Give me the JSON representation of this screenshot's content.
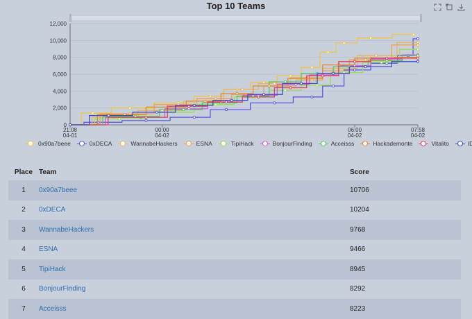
{
  "chart_data": {
    "type": "line",
    "title": "Top 10 Teams",
    "x_ticks": [
      {
        "time": "21:08",
        "date": "04-01"
      },
      {
        "time": "00:00",
        "date": "04-02"
      },
      {
        "time": "06:00",
        "date": "04-02"
      },
      {
        "time": "07:58",
        "date": "04-02"
      }
    ],
    "x_range": [
      "04-01 21:08",
      "04-02 07:58"
    ],
    "ylim": [
      0,
      12000
    ],
    "y_ticks": [
      "0",
      "2,000",
      "4,000",
      "6,000",
      "8,000",
      "10,000",
      "12,000"
    ],
    "legend_position": "bottom",
    "series": [
      {
        "name": "0x90a7beee",
        "color": "#f2c349",
        "points": [
          [
            "21:08",
            0
          ],
          [
            "21:50",
            1400
          ],
          [
            "23:00",
            2000
          ],
          [
            "00:30",
            2600
          ],
          [
            "01:30",
            3400
          ],
          [
            "02:20",
            4200
          ],
          [
            "03:10",
            5000
          ],
          [
            "04:00",
            5800
          ],
          [
            "04:40",
            6800
          ],
          [
            "05:10",
            8600
          ],
          [
            "05:40",
            9700
          ],
          [
            "06:30",
            10300
          ],
          [
            "07:50",
            10706
          ]
        ]
      },
      {
        "name": "0xDECA",
        "color": "#5a55e6",
        "points": [
          [
            "21:08",
            0
          ],
          [
            "22:00",
            300
          ],
          [
            "23:30",
            500
          ],
          [
            "01:00",
            900
          ],
          [
            "02:00",
            1800
          ],
          [
            "03:30",
            2600
          ],
          [
            "04:40",
            3300
          ],
          [
            "05:20",
            4600
          ],
          [
            "06:00",
            6500
          ],
          [
            "07:00",
            7300
          ],
          [
            "07:40",
            8200
          ],
          [
            "07:58",
            10204
          ]
        ]
      },
      {
        "name": "WannabeHackers",
        "color": "#e8b55a",
        "points": [
          [
            "21:08",
            0
          ],
          [
            "22:30",
            900
          ],
          [
            "00:00",
            1700
          ],
          [
            "01:20",
            2800
          ],
          [
            "02:30",
            4200
          ],
          [
            "03:30",
            4900
          ],
          [
            "04:30",
            5600
          ],
          [
            "05:30",
            6700
          ],
          [
            "06:40",
            8200
          ],
          [
            "07:58",
            9768
          ]
        ]
      },
      {
        "name": "ESNA",
        "color": "#f0a050",
        "points": [
          [
            "21:08",
            0
          ],
          [
            "23:00",
            1300
          ],
          [
            "00:30",
            2400
          ],
          [
            "01:40",
            3100
          ],
          [
            "02:40",
            3600
          ],
          [
            "03:40",
            4600
          ],
          [
            "04:40",
            5300
          ],
          [
            "05:20",
            6400
          ],
          [
            "06:20",
            7700
          ],
          [
            "07:58",
            9466
          ]
        ]
      },
      {
        "name": "TipiHack",
        "color": "#9bdc55",
        "points": [
          [
            "21:08",
            0
          ],
          [
            "22:40",
            700
          ],
          [
            "00:20",
            1500
          ],
          [
            "01:40",
            2400
          ],
          [
            "02:50",
            3300
          ],
          [
            "03:50",
            4100
          ],
          [
            "04:50",
            4700
          ],
          [
            "05:40",
            6200
          ],
          [
            "06:50",
            7400
          ],
          [
            "07:58",
            8945
          ]
        ]
      },
      {
        "name": "BonjourFinding",
        "color": "#d159d8",
        "points": [
          [
            "21:08",
            0
          ],
          [
            "23:20",
            900
          ],
          [
            "00:50",
            1900
          ],
          [
            "02:00",
            2700
          ],
          [
            "03:00",
            3500
          ],
          [
            "04:10",
            4800
          ],
          [
            "05:00",
            5900
          ],
          [
            "06:00",
            7000
          ],
          [
            "07:00",
            7800
          ],
          [
            "07:58",
            8292
          ]
        ]
      },
      {
        "name": "Acceisss",
        "color": "#57c26a",
        "points": [
          [
            "21:08",
            0
          ],
          [
            "23:10",
            1000
          ],
          [
            "00:40",
            1800
          ],
          [
            "01:50",
            2600
          ],
          [
            "02:50",
            3400
          ],
          [
            "03:50",
            5100
          ],
          [
            "04:50",
            6100
          ],
          [
            "05:50",
            6900
          ],
          [
            "07:00",
            7600
          ],
          [
            "07:58",
            8223
          ]
        ]
      },
      {
        "name": "Hackademonte",
        "color": "#e08833",
        "points": [
          [
            "21:08",
            0
          ],
          [
            "22:50",
            1200
          ],
          [
            "00:10",
            2100
          ],
          [
            "01:20",
            2800
          ],
          [
            "02:20",
            3700
          ],
          [
            "03:20",
            4600
          ],
          [
            "04:30",
            5500
          ],
          [
            "05:30",
            7100
          ],
          [
            "06:30",
            7900
          ],
          [
            "07:58",
            8000
          ]
        ]
      },
      {
        "name": "Vitalito",
        "color": "#e0405a",
        "points": [
          [
            "21:08",
            0
          ],
          [
            "23:30",
            900
          ],
          [
            "00:50",
            2200
          ],
          [
            "02:00",
            2700
          ],
          [
            "03:00",
            3300
          ],
          [
            "04:00",
            4400
          ],
          [
            "05:00",
            5800
          ],
          [
            "06:00",
            7500
          ],
          [
            "07:00",
            7900
          ],
          [
            "07:58",
            7900
          ]
        ]
      },
      {
        "name": "ID-IoT",
        "color": "#3b4cc8",
        "points": [
          [
            "21:08",
            0
          ],
          [
            "22:20",
            1100
          ],
          [
            "23:50",
            1500
          ],
          [
            "01:00",
            2300
          ],
          [
            "02:10",
            2900
          ],
          [
            "03:10",
            3600
          ],
          [
            "04:20",
            4900
          ],
          [
            "05:20",
            6100
          ],
          [
            "06:20",
            6900
          ],
          [
            "07:58",
            7500
          ]
        ]
      }
    ]
  },
  "table": {
    "headers": {
      "place": "Place",
      "team": "Team",
      "score": "Score"
    },
    "rows": [
      {
        "place": "1",
        "team": "0x90a7beee",
        "score": "10706"
      },
      {
        "place": "2",
        "team": "0xDECA",
        "score": "10204"
      },
      {
        "place": "3",
        "team": "WannabeHackers",
        "score": "9768"
      },
      {
        "place": "4",
        "team": "ESNA",
        "score": "9466"
      },
      {
        "place": "5",
        "team": "TipiHack",
        "score": "8945"
      },
      {
        "place": "6",
        "team": "BonjourFinding",
        "score": "8292"
      },
      {
        "place": "7",
        "team": "Acceisss",
        "score": "8223"
      }
    ]
  },
  "toolbox": {
    "icons": [
      "zoom-icon",
      "restore-icon",
      "save-image-icon"
    ]
  }
}
